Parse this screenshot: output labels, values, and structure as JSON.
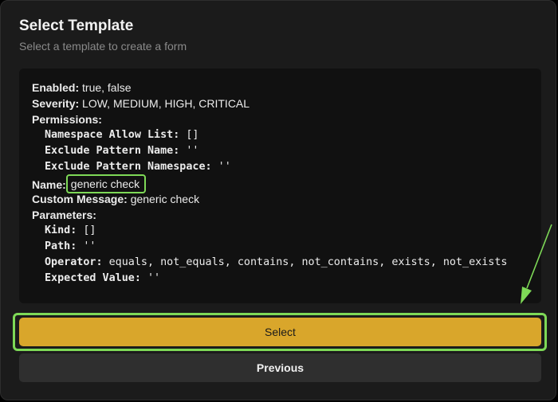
{
  "dialog": {
    "title": "Select Template",
    "subtitle": "Select a template to create a form"
  },
  "template": {
    "enabled": {
      "key": "Enabled:",
      "value": "true, false"
    },
    "severity": {
      "key": "Severity:",
      "value": "LOW, MEDIUM, HIGH, CRITICAL"
    },
    "permissions": {
      "key": "Permissions:",
      "items": [
        {
          "key": "Namespace Allow List:",
          "value": "[]"
        },
        {
          "key": "Exclude Pattern Name:",
          "value": "''"
        },
        {
          "key": "Exclude Pattern Namespace:",
          "value": "''"
        }
      ]
    },
    "name": {
      "key": "Name:",
      "value": "generic check"
    },
    "custom_message": {
      "key": "Custom Message:",
      "value": "generic check"
    },
    "parameters": {
      "key": "Parameters:",
      "items": [
        {
          "key": "Kind:",
          "value": "[]"
        },
        {
          "key": "Path:",
          "value": "''"
        },
        {
          "key": "Operator:",
          "value": "equals, not_equals, contains, not_contains, exists, not_exists"
        },
        {
          "key": "Expected Value:",
          "value": "''"
        }
      ]
    }
  },
  "buttons": {
    "select_label": "Select",
    "previous_label": "Previous"
  },
  "colors": {
    "accent": "#d9a62b",
    "annotation": "#7ed957",
    "background": "#1b1b1b"
  }
}
